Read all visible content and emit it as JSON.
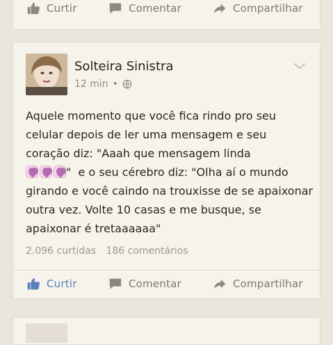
{
  "top_post": {
    "actions": {
      "like": "Curtir",
      "comment": "Comentar",
      "share": "Compartilhar"
    }
  },
  "post": {
    "author": "Solteira Sinistra",
    "time": "12 min",
    "privacy_icon": "globe-icon",
    "text_parts": {
      "line1": "Aquele momento que você fica rindo pro seu celular depois de ler uma mensagem e seu coração diz: \"Aaah que mensagem linda",
      "line2": "\"  e o seu cérebro diz: \"Olha aí o mundo girando e você caindo na trouxisse de se apaixonar outra vez. Volte 10 casas e me busque, se apaixonar é tretaaaaaa\""
    },
    "emoji_icon": "heart-emoji-icon",
    "likes": "2.096 curtidas",
    "comments": "186 comentários",
    "actions": {
      "like": "Curtir",
      "comment": "Comentar",
      "share": "Compartilhar"
    }
  },
  "colors": {
    "background": "#e9e6dc",
    "card": "#f6f4ea",
    "accent": "#5b7fbd",
    "muted": "#7b776f"
  }
}
